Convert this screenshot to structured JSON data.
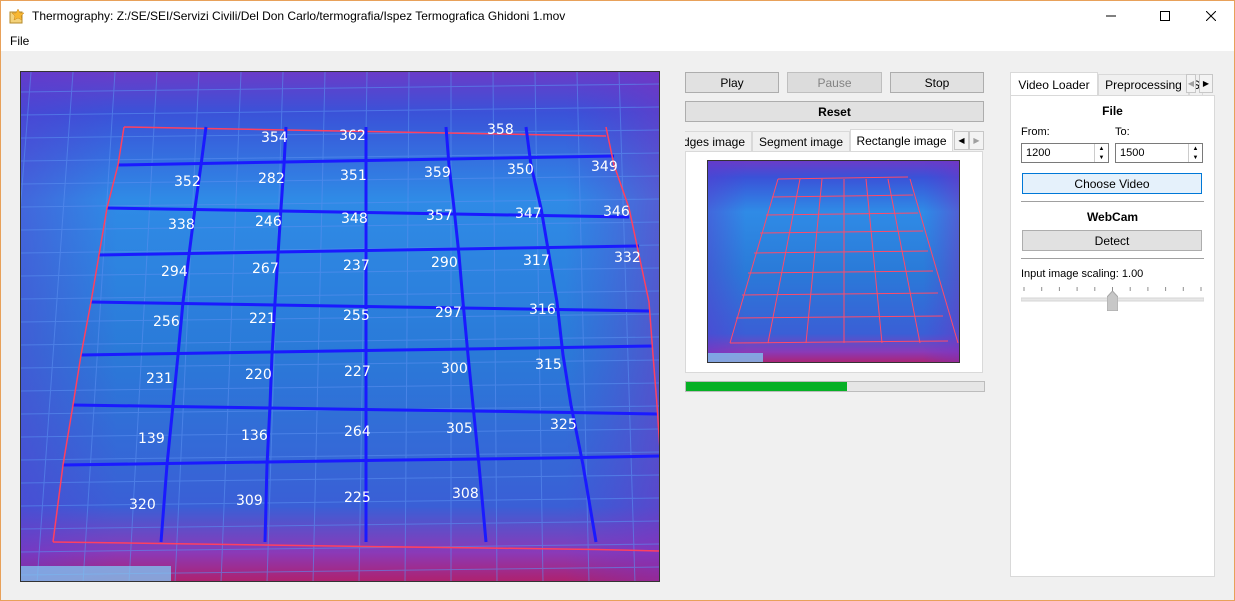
{
  "window": {
    "title": "Thermography: Z:/SE/SEI/Servizi Civili/Del Don Carlo/termografia/Ispez Termografica Ghidoni 1.mov",
    "menu": [
      "File"
    ]
  },
  "controls": {
    "play": "Play",
    "pause": "Pause",
    "stop": "Stop",
    "reset": "Reset"
  },
  "image_tabs": {
    "items": [
      "Edges image",
      "Segment image",
      "Rectangle image"
    ],
    "active": "Rectangle image"
  },
  "progress": {
    "value": 0.54
  },
  "right_tabs": {
    "items": [
      "Video Loader",
      "Preprocessing",
      "S"
    ],
    "active": "Video Loader"
  },
  "video_loader": {
    "file_title": "File",
    "from_label": "From:",
    "to_label": "To:",
    "from_value": "1200",
    "to_value": "1500",
    "choose_video": "Choose Video",
    "webcam_title": "WebCam",
    "detect": "Detect",
    "scaling_label": "Input image scaling: 1.00",
    "scaling_value": 0.5
  },
  "panel_labels": [
    [
      "354",
      "362",
      "358"
    ],
    [
      "352",
      "282",
      "351",
      "359",
      "350",
      "349"
    ],
    [
      "338",
      "246",
      "348",
      "357",
      "347",
      "346"
    ],
    [
      "294",
      "267",
      "237",
      "290",
      "317",
      "332"
    ],
    [
      "256",
      "221",
      "255",
      "297",
      "316"
    ],
    [
      "231",
      "220",
      "227",
      "300",
      "315"
    ],
    [
      "139",
      "136",
      "264",
      "305",
      "325"
    ],
    [
      "320",
      "309",
      "225",
      "308"
    ]
  ],
  "colors": {
    "accent_border": "#e8a15a",
    "progress": "#06b025",
    "grid_blue": "#1a1aff",
    "grid_red": "#ff4060",
    "thermal_bg": "#2a7ad8"
  }
}
